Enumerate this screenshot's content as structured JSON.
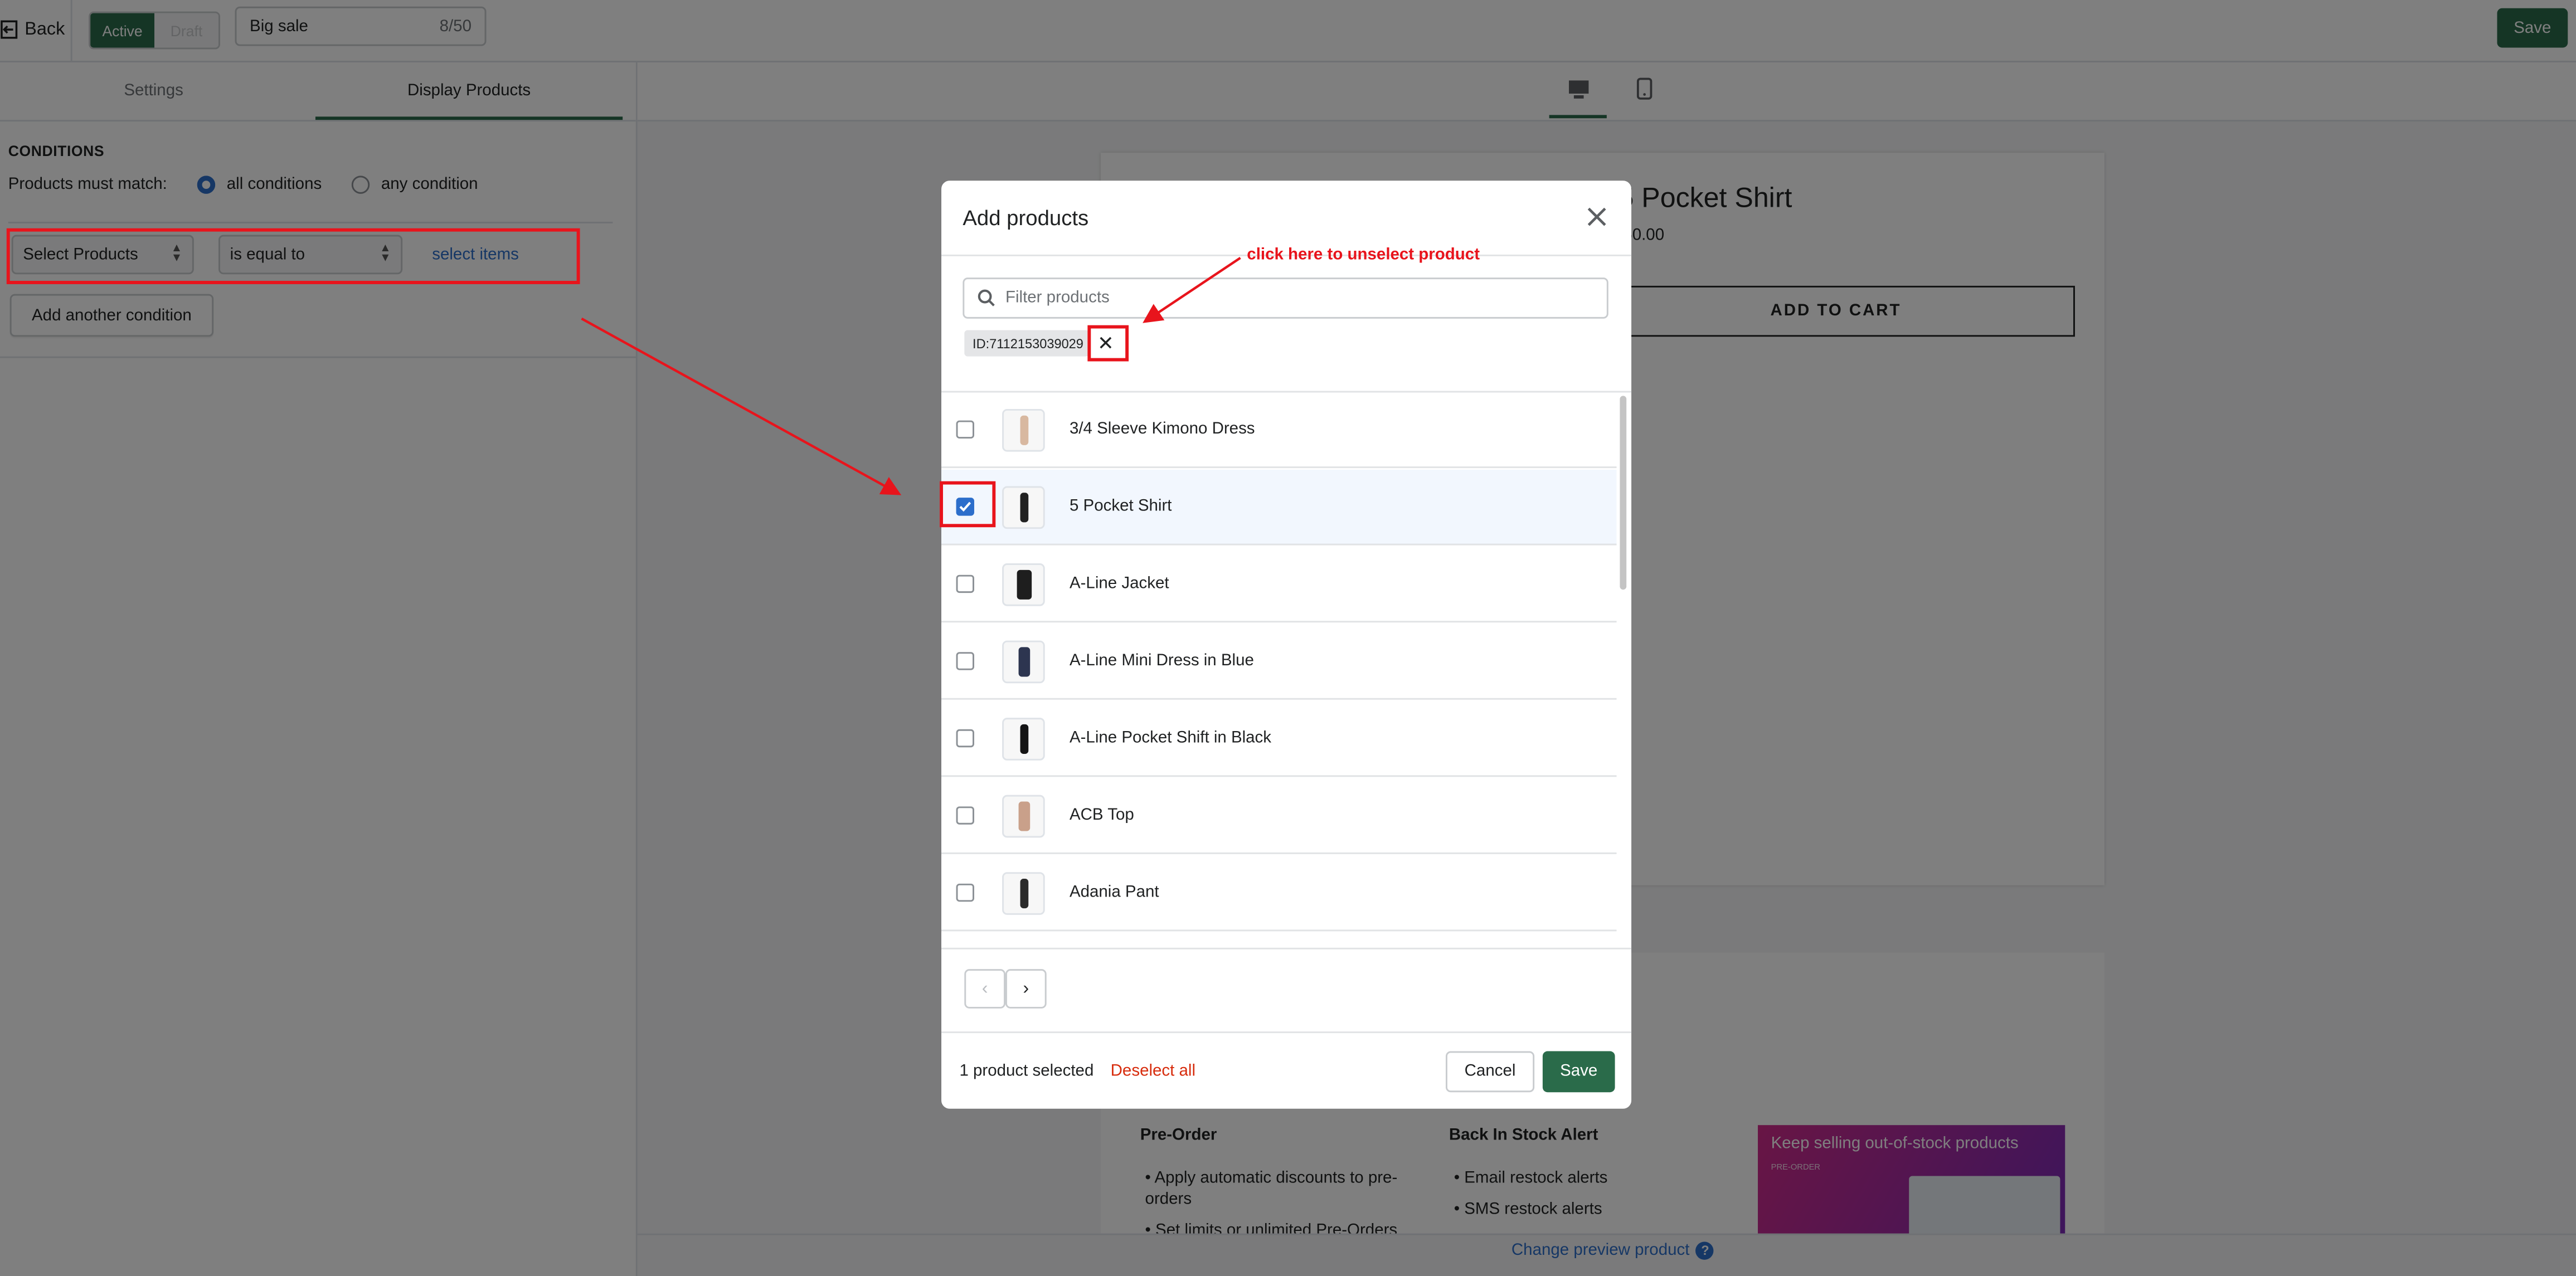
{
  "topbar": {
    "back_label": "Back",
    "status_active": "Active",
    "status_draft": "Draft",
    "campaign_name": "Big sale",
    "char_count": "8/50",
    "save_label": "Save"
  },
  "left_panel": {
    "tabs": [
      {
        "label": "Settings",
        "active": false
      },
      {
        "label": "Display Products",
        "active": true
      }
    ],
    "conditions_heading": "CONDITIONS",
    "match_label": "Products must match:",
    "match_options": [
      {
        "label": "all conditions",
        "selected": true
      },
      {
        "label": "any condition",
        "selected": false
      }
    ],
    "condition": {
      "field": "Select Products",
      "operator": "is equal to",
      "value_link": "select items"
    },
    "add_condition_label": "Add another condition"
  },
  "preview": {
    "device_icons": [
      "desktop-icon",
      "mobile-icon"
    ],
    "product_title": "5 Pocket Shirt",
    "product_price": "50.00",
    "add_to_cart": "ADD TO CART",
    "section_columns": [
      {
        "heading": "Pre-Order",
        "items": [
          "Apply automatic discounts to pre-orders",
          "Set limits or unlimited Pre-Orders"
        ]
      },
      {
        "heading": "Back In Stock Alert",
        "items": [
          "Email restock alerts",
          "SMS restock alerts"
        ]
      }
    ],
    "promo_title": "Keep selling out-of-stock products",
    "promo_subtitle": "PRE-ORDER",
    "change_preview_label": "Change preview product"
  },
  "modal": {
    "title": "Add products",
    "search_placeholder": "Filter products",
    "selected_tag": "ID:7112153039029",
    "products": [
      {
        "name": "3/4 Sleeve Kimono Dress",
        "checked": false,
        "thumb_color": "#d8b8a0"
      },
      {
        "name": "5 Pocket Shirt",
        "checked": true,
        "thumb_color": "#222222"
      },
      {
        "name": "A-Line Jacket",
        "checked": false,
        "thumb_color": "#1e1e1e"
      },
      {
        "name": "A-Line Mini Dress in Blue",
        "checked": false,
        "thumb_color": "#2d3550"
      },
      {
        "name": "A-Line Pocket Shift in Black",
        "checked": false,
        "thumb_color": "#151515"
      },
      {
        "name": "ACB Top",
        "checked": false,
        "thumb_color": "#c9a08a"
      },
      {
        "name": "Adania Pant",
        "checked": false,
        "thumb_color": "#2a2a2a"
      }
    ],
    "selected_count_label": "1 product selected",
    "deselect_label": "Deselect all",
    "cancel_label": "Cancel",
    "save_label": "Save"
  },
  "annotation": {
    "text": "click here to  unselect product",
    "color": "#e8141c"
  },
  "colors": {
    "brand_green": "#2a6b4a",
    "link_blue": "#2c6ecb",
    "destructive_red": "#d72c0d"
  }
}
